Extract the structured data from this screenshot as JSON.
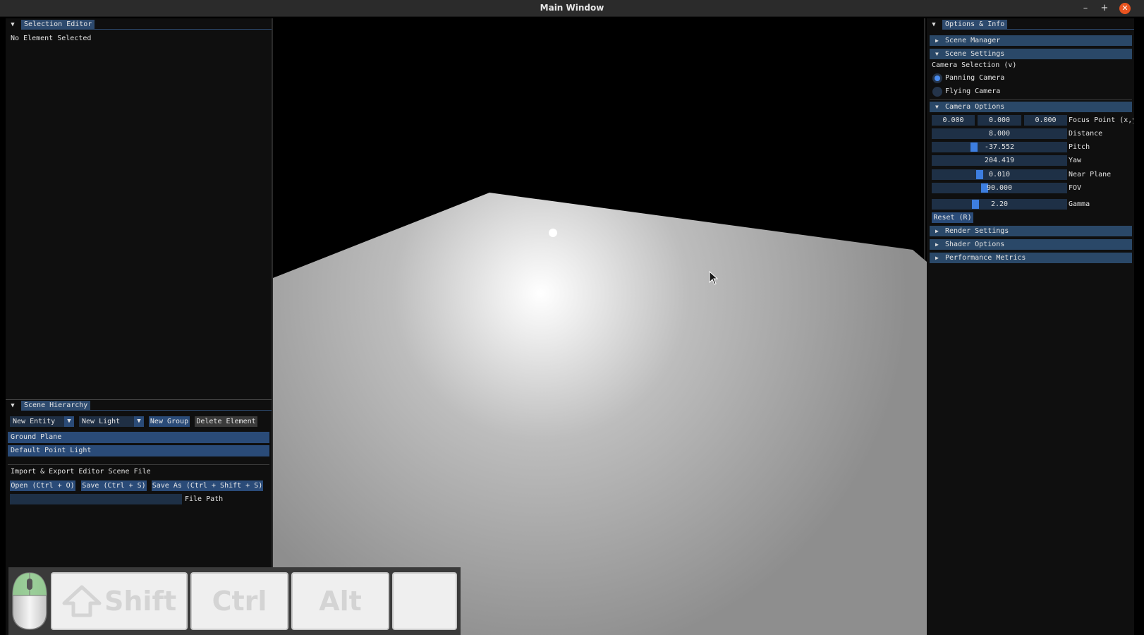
{
  "window": {
    "title": "Main Window",
    "minimize": "–",
    "maximize": "+",
    "close": "✕"
  },
  "selection_editor": {
    "title": "Selection Editor",
    "status": "No Element Selected"
  },
  "scene_hierarchy": {
    "title": "Scene Hierarchy",
    "new_entity": "New Entity",
    "new_light": "New Light",
    "new_group": "New Group",
    "delete_element": "Delete Element",
    "items": [
      "Ground Plane",
      "Default Point Light"
    ],
    "import_export_label": "Import & Export Editor Scene File",
    "open": "Open (Ctrl + O)",
    "save": "Save (Ctrl + S)",
    "save_as": "Save As (Ctrl + Shift + S)",
    "file_path_value": "",
    "file_path_label": "File Path"
  },
  "options": {
    "title": "Options & Info",
    "scene_manager": "Scene Manager",
    "scene_settings": "Scene Settings",
    "camera_selection": "Camera Selection (v)",
    "panning_camera": "Panning Camera",
    "flying_camera": "Flying Camera",
    "selected_camera": "Panning Camera",
    "camera_options": "Camera Options",
    "focus_x": "0.000",
    "focus_y": "0.000",
    "focus_z": "0.000",
    "focus_label": "Focus Point (x,y",
    "distance": "8.000",
    "distance_label": "Distance",
    "pitch": "-37.552",
    "pitch_label": "Pitch",
    "yaw": "204.419",
    "yaw_label": "Yaw",
    "near_plane": "0.010",
    "near_plane_label": "Near Plane",
    "fov": "90.000",
    "fov_label": "FOV",
    "gamma": "2.20",
    "gamma_label": "Gamma",
    "reset": "Reset (R)",
    "render_settings": "Render Settings",
    "shader_options": "Shader Options",
    "performance_metrics": "Performance Metrics"
  },
  "keys": {
    "shift": "Shift",
    "ctrl": "Ctrl",
    "alt": "Alt",
    "blank": ""
  }
}
